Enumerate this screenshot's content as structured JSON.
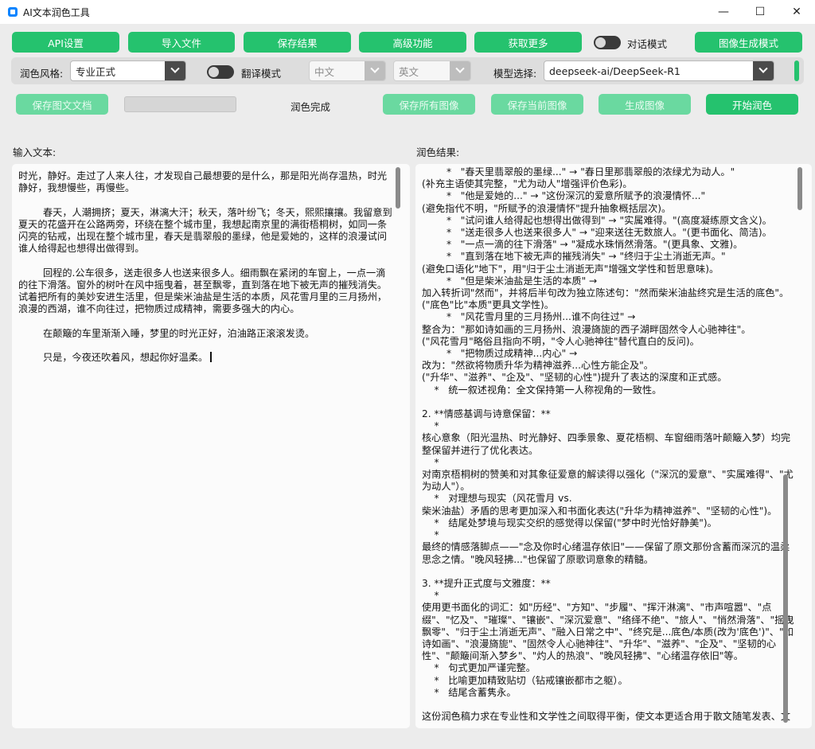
{
  "window": {
    "title": "AI文本润色工具",
    "minimize_glyph": "—",
    "maximize_glyph": "☐",
    "close_glyph": "✕"
  },
  "toolbar": {
    "api_settings": "API设置",
    "import_file": "导入文件",
    "save_result": "保存结果",
    "advanced": "高级功能",
    "get_more": "获取更多",
    "chat_mode_label": "对话模式",
    "image_gen_mode": "图像生成模式"
  },
  "settings": {
    "style_label": "润色风格:",
    "style_value": "专业正式",
    "translate_label": "翻译模式",
    "source_lang": "中文",
    "target_lang": "英文",
    "model_label": "模型选择:",
    "model_value": "deepseek-ai/DeepSeek-R1"
  },
  "actions": {
    "save_image_doc": "保存图文文档",
    "status": "润色完成",
    "save_all_images": "保存所有图像",
    "save_current_image": "保存当前图像",
    "generate_image": "生成图像",
    "start_polish": "开始润色"
  },
  "input": {
    "label": "输入文本:",
    "text": "时光，静好。走过了人来人往，才发现自己最想要的是什么，那是阳光尚存温热，时光静好，我想慢些，再慢些。\n\n        春天，人潮拥挤；夏天，淋漓大汗；秋天，落叶纷飞；冬天，熙熙攘攘。我留意到夏天的花盛开在公路两旁，环绕在整个城市里，我想起南京里的满街梧桐树，如同一条闪亮的钻戒，出现在整个城市里，春天是翡翠般的墨绿，他是爱她的，这样的浪漫试问谁人给得起也想得出做得到。\n\n        回程的.公车很多，送走很多人也送来很多人。细雨飘在紧闭的车窗上，一点一滴的往下滑落。窗外的树叶在风中摇曳着，甚至飘零，直到落在地下被无声的摧残消失。试着把所有的美妙安进生活里，但是柴米油盐是生活的本质，风花雪月里的三月扬州，浪漫的西湖，谁不向往过，把物质过成精神，需要多强大的内心。\n\n        在颠簸的车里渐渐入睡，梦里的时光正好，泊油路正滚滚发烫。\n\n        只是，今夜还吹着风，想起你好温柔。"
  },
  "output": {
    "label": "润色结果:",
    "text": "        *   \"春天里翡翠般的墨绿...\" → \"春日里那翡翠般的浓绿尤为动人。\"\n(补充主语使其完整，\"尤为动人\"增强评价色彩)。\n        *   \"他是爱她的...\" → \"这份深沉的爱意所赋予的浪漫情怀...\"\n(避免指代不明，\"所赋予的浪漫情怀\"提升抽象概括层次)。\n        *   \"试问谁人给得起也想得出做得到\" → \"实属难得。\"(高度凝练原文含义)。\n        *   \"送走很多人也送来很多人\" → \"迎来送往无数旅人。\"(更书面化、简洁)。\n        *   \"一点一滴的往下滑落\" → \"凝成水珠悄然滑落。\"(更具象、文雅)。\n        *   \"直到落在地下被无声的摧残消失\" → \"终归于尘土消逝无声。\"\n(避免口语化\"地下\"，用\"归于尘土消逝无声\"增强文学性和哲思意味)。\n        *   \"但是柴米油盐是生活的本质\" →\n加入转折词\"然而\"，并将后半句改为独立陈述句：\"然而柴米油盐终究是生活的底色\"。(\"底色\"比\"本质\"更具文学性)。\n        *   \"风花雪月里的三月扬州...谁不向往过\" →\n整合为：\"那如诗如画的三月扬州、浪漫旖旎的西子湖畔固然令人心驰神往\"。\n(\"风花雪月\"略俗且指向不明，\"令人心驰神往\"替代直白的反问)。\n        *   \"把物质过成精神...内心\" →\n改为：\"然欲将物质升华为精神滋养...心性方能企及\"。\n(\"升华\"、\"滋养\"、\"企及\"、\"坚韧的心性\")提升了表达的深度和正式感。\n    *   统一叙述视角：全文保持第一人称视角的一致性。\n\n2. **情感基调与诗意保留：**\n    *\n核心意象（阳光温热、时光静好、四季景象、夏花梧桐、车窗细雨落叶颠簸入梦）均完整保留并进行了优化表达。\n    *\n对南京梧桐树的赞美和对其象征爱意的解读得以强化（\"深沉的爱意\"、\"实属难得\"、\"尤为动人\"）。\n    *   对理想与现实（风花雪月 vs.\n柴米油盐）矛盾的思考更加深入和书面化表达(\"升华为精神滋养\"、\"坚韧的心性\")。\n    *   结尾处梦境与现实交织的感觉得以保留(\"梦中时光恰好静美\")。\n    *\n最终的情感落脚点——\"念及你时心绪温存依旧\"——保留了原文那份含蓄而深沉的温柔思念之情。\"晚风轻拂...\"也保留了原歌词意象的精髓。\n\n3. **提升正式度与文雅度：**\n    *\n使用更书面化的词汇：如\"历经\"、\"方知\"、\"步履\"、\"挥汗淋漓\"、\"市声喧嚣\"、\"点缀\"、\"忆及\"、\"璀璨\"、\"镶嵌\"、\"深沉爱意\"、\"络绎不绝\"、\"旅人\"、\"悄然滑落\"、\"摇曳飘零\"、\"归于尘土消逝无声\"、\"融入日常之中\"、\"终究是...底色/本质(改为'底色')\"、\"如诗如画\"、\"浪漫旖旎\"、\"固然令人心驰神往\"、\"升华\"、\"滋养\"、\"企及\"、\"坚韧的心性\"、\"颠簸间渐入梦乡\"、\"灼人的热浪\"、\"晚风轻拂\"、\"心绪温存依旧\"等。\n    *   句式更加严谨完整。\n    *   比喻更加精致贴切（钻戒镶嵌都市之躯）。\n    *   结尾含蓄隽永。\n\n这份润色稿力求在专业性和文学性之间取得平衡，使文本更适合用于散文随笔发表、文学创作投稿或需要展现优美文笔和深刻思考的正式场合。"
  }
}
